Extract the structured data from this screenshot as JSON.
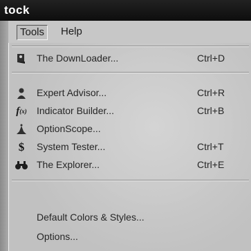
{
  "window": {
    "title": "tock"
  },
  "menubar": [
    {
      "label": "Tools",
      "active": true
    },
    {
      "label": "Help",
      "active": false
    }
  ],
  "tools_menu": {
    "items": [
      {
        "icon": "downloader-icon",
        "label": "The DownLoader...",
        "shortcut": "Ctrl+D"
      },
      {
        "icon": "expert-advisor-icon",
        "label": "Expert Advisor...",
        "shortcut": "Ctrl+R"
      },
      {
        "icon": "indicator-builder-icon",
        "label": "Indicator Builder...",
        "shortcut": "Ctrl+B"
      },
      {
        "icon": "optionscope-icon",
        "label": "OptionScope...",
        "shortcut": ""
      },
      {
        "icon": "system-tester-icon",
        "label": "System Tester...",
        "shortcut": "Ctrl+T"
      },
      {
        "icon": "explorer-icon",
        "label": "The Explorer...",
        "shortcut": "Ctrl+E"
      },
      {
        "icon": "",
        "label": "Default Colors & Styles...",
        "shortcut": ""
      },
      {
        "icon": "",
        "label": "Options...",
        "shortcut": ""
      }
    ]
  }
}
